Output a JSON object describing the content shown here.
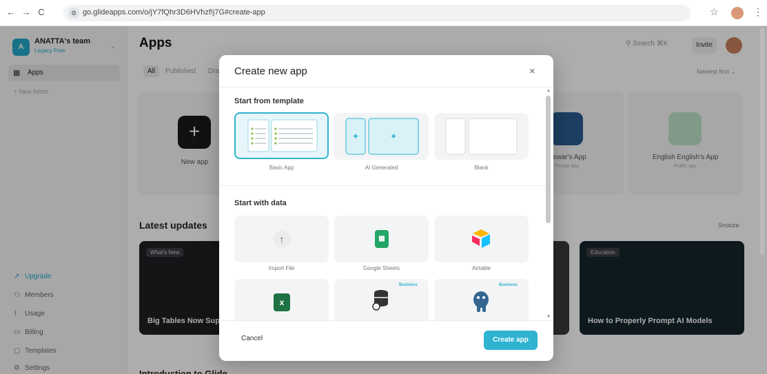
{
  "browser": {
    "url": "go.glideapps.com/o/jY7fQhr3D6HVhzf!j7G#create-app",
    "nav": {
      "back": "←",
      "forward": "→",
      "reload": "C"
    }
  },
  "sidebar": {
    "team_name": "ANATTA's team",
    "team_initial": "A",
    "team_plan": "Legacy Free",
    "apps_label": "Apps",
    "new_folder_label": "+ New folder",
    "bottom_items": [
      {
        "label": "Upgrade",
        "icon": "upgrade-icon"
      },
      {
        "label": "Members",
        "icon": "members-icon"
      },
      {
        "label": "Usage",
        "icon": "usage-icon"
      },
      {
        "label": "Billing",
        "icon": "billing-icon"
      },
      {
        "label": "Templates",
        "icon": "templates-icon"
      },
      {
        "label": "Settings",
        "icon": "settings-icon"
      }
    ]
  },
  "main": {
    "title": "Apps",
    "filters": [
      "All",
      "Published",
      "Dra"
    ],
    "search_placeholder": "Search",
    "search_shortcut": "⌘K",
    "invite_label": "Invite",
    "sort_label": "Newest first",
    "cards": [
      {
        "label": "New app",
        "sub": ""
      },
      {
        "label": "...swar's App",
        "sub": "Private app"
      },
      {
        "label": "English English's App",
        "sub": "Public app"
      }
    ],
    "latest_updates": "Latest updates",
    "snooze_label": "Snooze",
    "updates": [
      {
        "badge": "What's New",
        "title": "Big Tables Now Sup"
      },
      {
        "badge": "Education",
        "title": "How to Properly Prompt AI Models"
      }
    ],
    "intro_heading": "Introduction to Glide"
  },
  "modal": {
    "title": "Create new app",
    "close": "×",
    "template_heading": "Start from template",
    "templates": [
      {
        "label": "Basic App",
        "selected": true
      },
      {
        "label": "AI Generated",
        "selected": false
      },
      {
        "label": "Blank",
        "selected": false
      }
    ],
    "data_heading": "Start with data",
    "data_sources": [
      {
        "label": "Import File",
        "icon": "upload-arrow-icon",
        "business": ""
      },
      {
        "label": "Google Sheets",
        "icon": "google-sheets-icon",
        "business": ""
      },
      {
        "label": "Airtable",
        "icon": "airtable-icon",
        "business": ""
      },
      {
        "label": "",
        "icon": "excel-icon",
        "business": ""
      },
      {
        "label": "",
        "icon": "database-icon",
        "business": "Business"
      },
      {
        "label": "",
        "icon": "postgresql-icon",
        "business": "Business"
      }
    ],
    "cancel_label": "Cancel",
    "create_label": "Create app"
  },
  "colors": {
    "accent": "#2fb3d1",
    "sheets_green": "#23a566",
    "excel_green": "#1f7244"
  }
}
